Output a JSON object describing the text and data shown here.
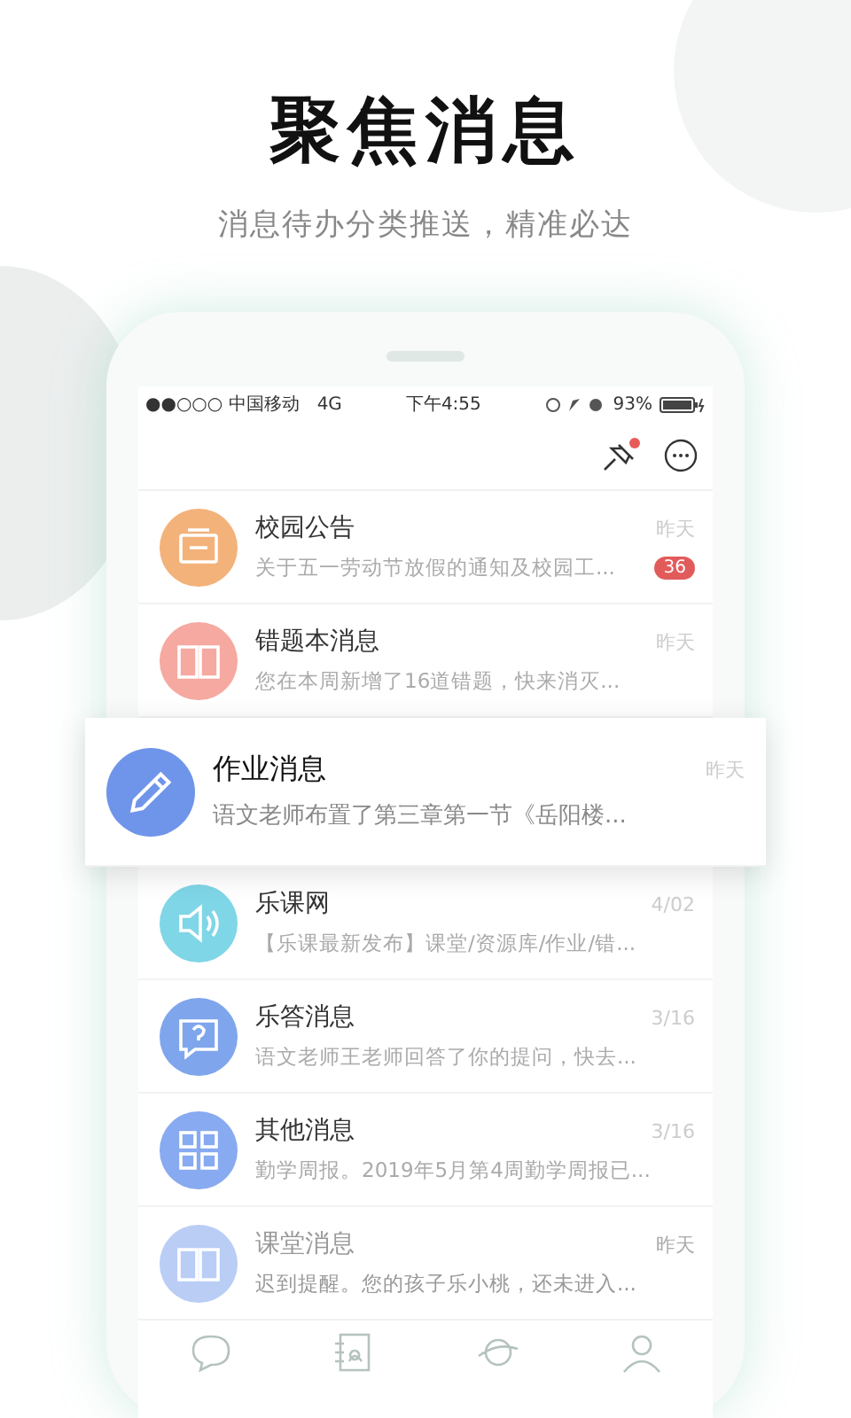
{
  "headline": "聚焦消息",
  "subtitle": "消息待办分类推送，精准必达",
  "status_bar": {
    "carrier": "●●○○○ 中国移动",
    "network": "4G",
    "time": "下午4:55",
    "battery": "93%"
  },
  "header": {
    "pin_unread": true
  },
  "messages": [
    {
      "kind": "board",
      "color": "#f3b27a",
      "title": "校园公告",
      "preview": "关于五一劳动节放假的通知及校园工...",
      "time": "昨天",
      "badge": "36",
      "selected": false
    },
    {
      "kind": "book",
      "color": "#f5a9a0",
      "title": "错题本消息",
      "preview": "您在本周新增了16道错题，快来消灭...",
      "time": "昨天",
      "selected": false
    },
    {
      "kind": "pencil",
      "color": "#6f95ea",
      "title": "作业消息",
      "preview": "语文老师布置了第三章第一节《岳阳楼...",
      "time": "昨天",
      "selected": true
    },
    {
      "kind": "speaker",
      "color": "#7fd6e6",
      "title": "乐课网",
      "preview": "【乐课最新发布】课堂/资源库/作业/错...",
      "time": "4/02",
      "selected": false
    },
    {
      "kind": "question",
      "color": "#7fa6ec",
      "title": "乐答消息",
      "preview": "语文老师王老师回答了你的提问，快去...",
      "time": "3/16",
      "selected": false
    },
    {
      "kind": "grid",
      "color": "#88aaf0",
      "title": "其他消息",
      "preview": "勤学周报。2019年5月第4周勤学周报已...",
      "time": "3/16",
      "selected": false
    },
    {
      "kind": "book",
      "color": "#b9cdf5",
      "title": "课堂消息",
      "preview": "迟到提醒。您的孩子乐小桃，还未进入...",
      "time": "昨天",
      "selected": false
    }
  ],
  "tabs": [
    {
      "kind": "chat"
    },
    {
      "kind": "contacts"
    },
    {
      "kind": "planet"
    },
    {
      "kind": "person"
    }
  ]
}
